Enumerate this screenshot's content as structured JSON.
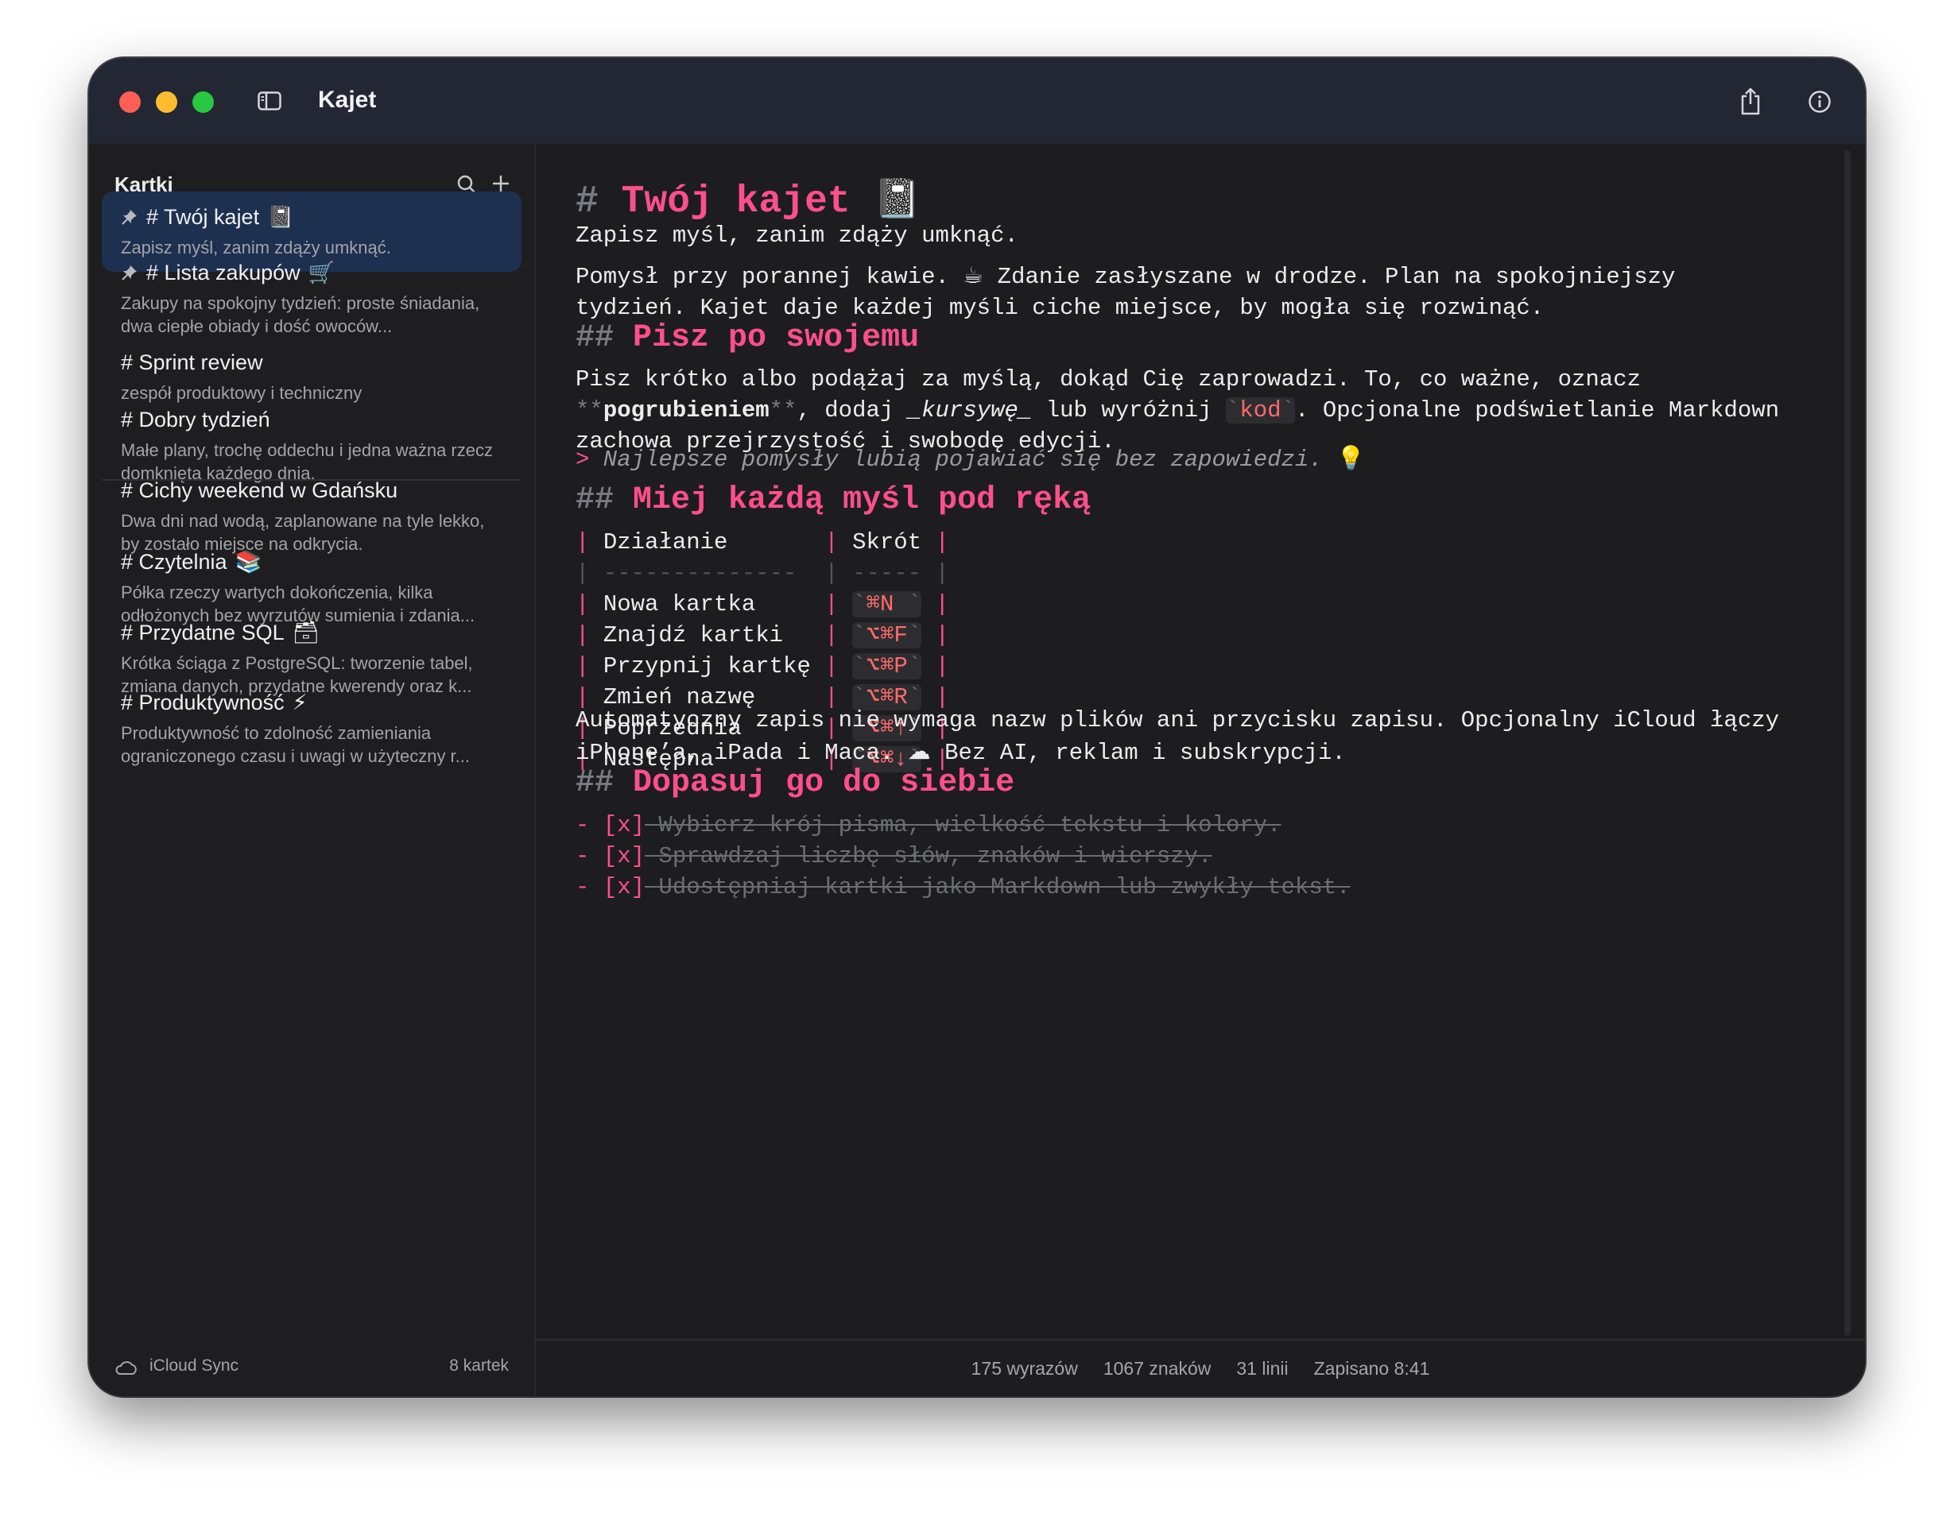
{
  "window": {
    "title": "Kajet"
  },
  "sidebar": {
    "title": "Kartki",
    "notes": [
      {
        "title": "# Twój kajet",
        "emoji": "📓",
        "pinned": true,
        "active": true,
        "preview": "Zapisz myśl, zanim zdąży umknąć."
      },
      {
        "title": "# Lista zakupów",
        "emoji": "🛒",
        "pinned": true,
        "active": false,
        "preview": "Zakupy na spokojny tydzień: proste śniadania, dwa ciepłe obiady i dość owoców..."
      },
      {
        "title": "# Sprint review",
        "emoji": "",
        "pinned": false,
        "active": false,
        "preview": "zespół produktowy i techniczny"
      },
      {
        "title": "# Dobry tydzień",
        "emoji": "",
        "pinned": false,
        "active": false,
        "preview": "Małe plany, trochę oddechu i jedna ważna rzecz domknięta każdego dnia."
      },
      {
        "title": "# Cichy weekend w Gdańsku",
        "emoji": "",
        "pinned": false,
        "active": false,
        "preview": "Dwa dni nad wodą, zaplanowane na tyle lekko, by zostało miejsce na odkrycia."
      },
      {
        "title": "# Czytelnia",
        "emoji": "📚",
        "pinned": false,
        "active": false,
        "preview": "Półka rzeczy wartych dokończenia, kilka odłożonych bez wyrzutów sumienia i zdania..."
      },
      {
        "title": "# Przydatne SQL",
        "emoji": "🗃",
        "pinned": false,
        "active": false,
        "preview": "Krótka ściąga z PostgreSQL: tworzenie tabel, zmiana danych, przydatne kwerendy oraz k..."
      },
      {
        "title": "# Produktywność",
        "emoji": "⚡",
        "pinned": false,
        "active": false,
        "preview": "Produktywność to zdolność zamieniania ograniczonego czasu i uwagi w użyteczny r..."
      }
    ],
    "footer": {
      "sync_label": "iCloud Sync",
      "count_label": "8 kartek"
    }
  },
  "editor": {
    "h1": {
      "mark": "#",
      "text": "Twój kajet",
      "emoji": "📓"
    },
    "p1": "Zapisz myśl, zanim zdąży umknąć.",
    "p2_line1_a": "Pomysł przy porannej kawie. ",
    "p2_emoji": "☕",
    "p2_line1_b": " Zdanie zasłyszane w drodze. Plan na spokojniejszy",
    "p2_line2": "tydzień. Kajet daje każdej myśli ciche miejsce, by mogła się rozwinąć.",
    "h2_a": {
      "mark": "##",
      "text": "Pisz po swojemu"
    },
    "p3_line1": "Pisz krótko albo podążaj za myślą, dokąd Cię zaprowadzi. To, co ważne, oznacz",
    "p3_bold_mark": "**",
    "p3_bold": "pogrubieniem",
    "p3_mid": ", dodaj ",
    "p3_italic": "_kursywę_",
    "p3_mid2": " lub wyróżnij ",
    "p3_code_bt": "`",
    "p3_code": "kod",
    "p3_tail": ". Opcjonalne podświetlanie Markdown",
    "p3_line3": "zachowa przejrzystość i swobodę edycji.",
    "quote_mark": ">",
    "quote": " Najlepsze pomysły lubią pojawiać się bez zapowiedzi.",
    "quote_emoji": "💡",
    "h2_b": {
      "mark": "##",
      "text": "Miej każdą myśl pod ręką"
    },
    "table": {
      "header_action": "Działanie",
      "header_shortcut": "Skrót",
      "sep_a": "--------------",
      "sep_b": "-----",
      "rows": [
        {
          "action": "Nowa kartka",
          "shortcut": "⌘N"
        },
        {
          "action": "Znajdź kartki",
          "shortcut": "⌥⌘F"
        },
        {
          "action": "Przypnij kartkę",
          "shortcut": "⌥⌘P"
        },
        {
          "action": "Zmień nazwę",
          "shortcut": "⌥⌘R"
        },
        {
          "action": "Poprzednia",
          "shortcut": "⌥⌘↑"
        },
        {
          "action": "Następna",
          "shortcut": "⌥⌘↓"
        }
      ]
    },
    "p4_line1": "Automatyczny zapis nie wymaga nazw plików ani przycisku zapisu. Opcjonalny iCloud łączy",
    "p4_line2_a": "iPhone’a, iPada i Maca. ",
    "p4_emoji": "☁",
    "p4_line2_b": " Bez AI, reklam i subskrypcji.",
    "h2_c": {
      "mark": "##",
      "text": "Dopasuj go do siebie"
    },
    "tasks": [
      {
        "dash": "-",
        "box": "[x]",
        "text": " Wybierz krój pisma, wielkość tekstu i kolory."
      },
      {
        "dash": "-",
        "box": "[x]",
        "text": " Sprawdzaj liczbę słów, znaków i wierszy."
      },
      {
        "dash": "-",
        "box": "[x]",
        "text": " Udostępniaj kartki jako Markdown lub zwykły tekst."
      }
    ]
  },
  "status": {
    "words": "175 wyrazów",
    "chars": "1067 znaków",
    "lines": "31 linii",
    "saved": "Zapisano 8:41"
  },
  "colors": {
    "accent": "#ff4f8b",
    "active_note": "#1e3050",
    "code": "#ff6b6b"
  }
}
